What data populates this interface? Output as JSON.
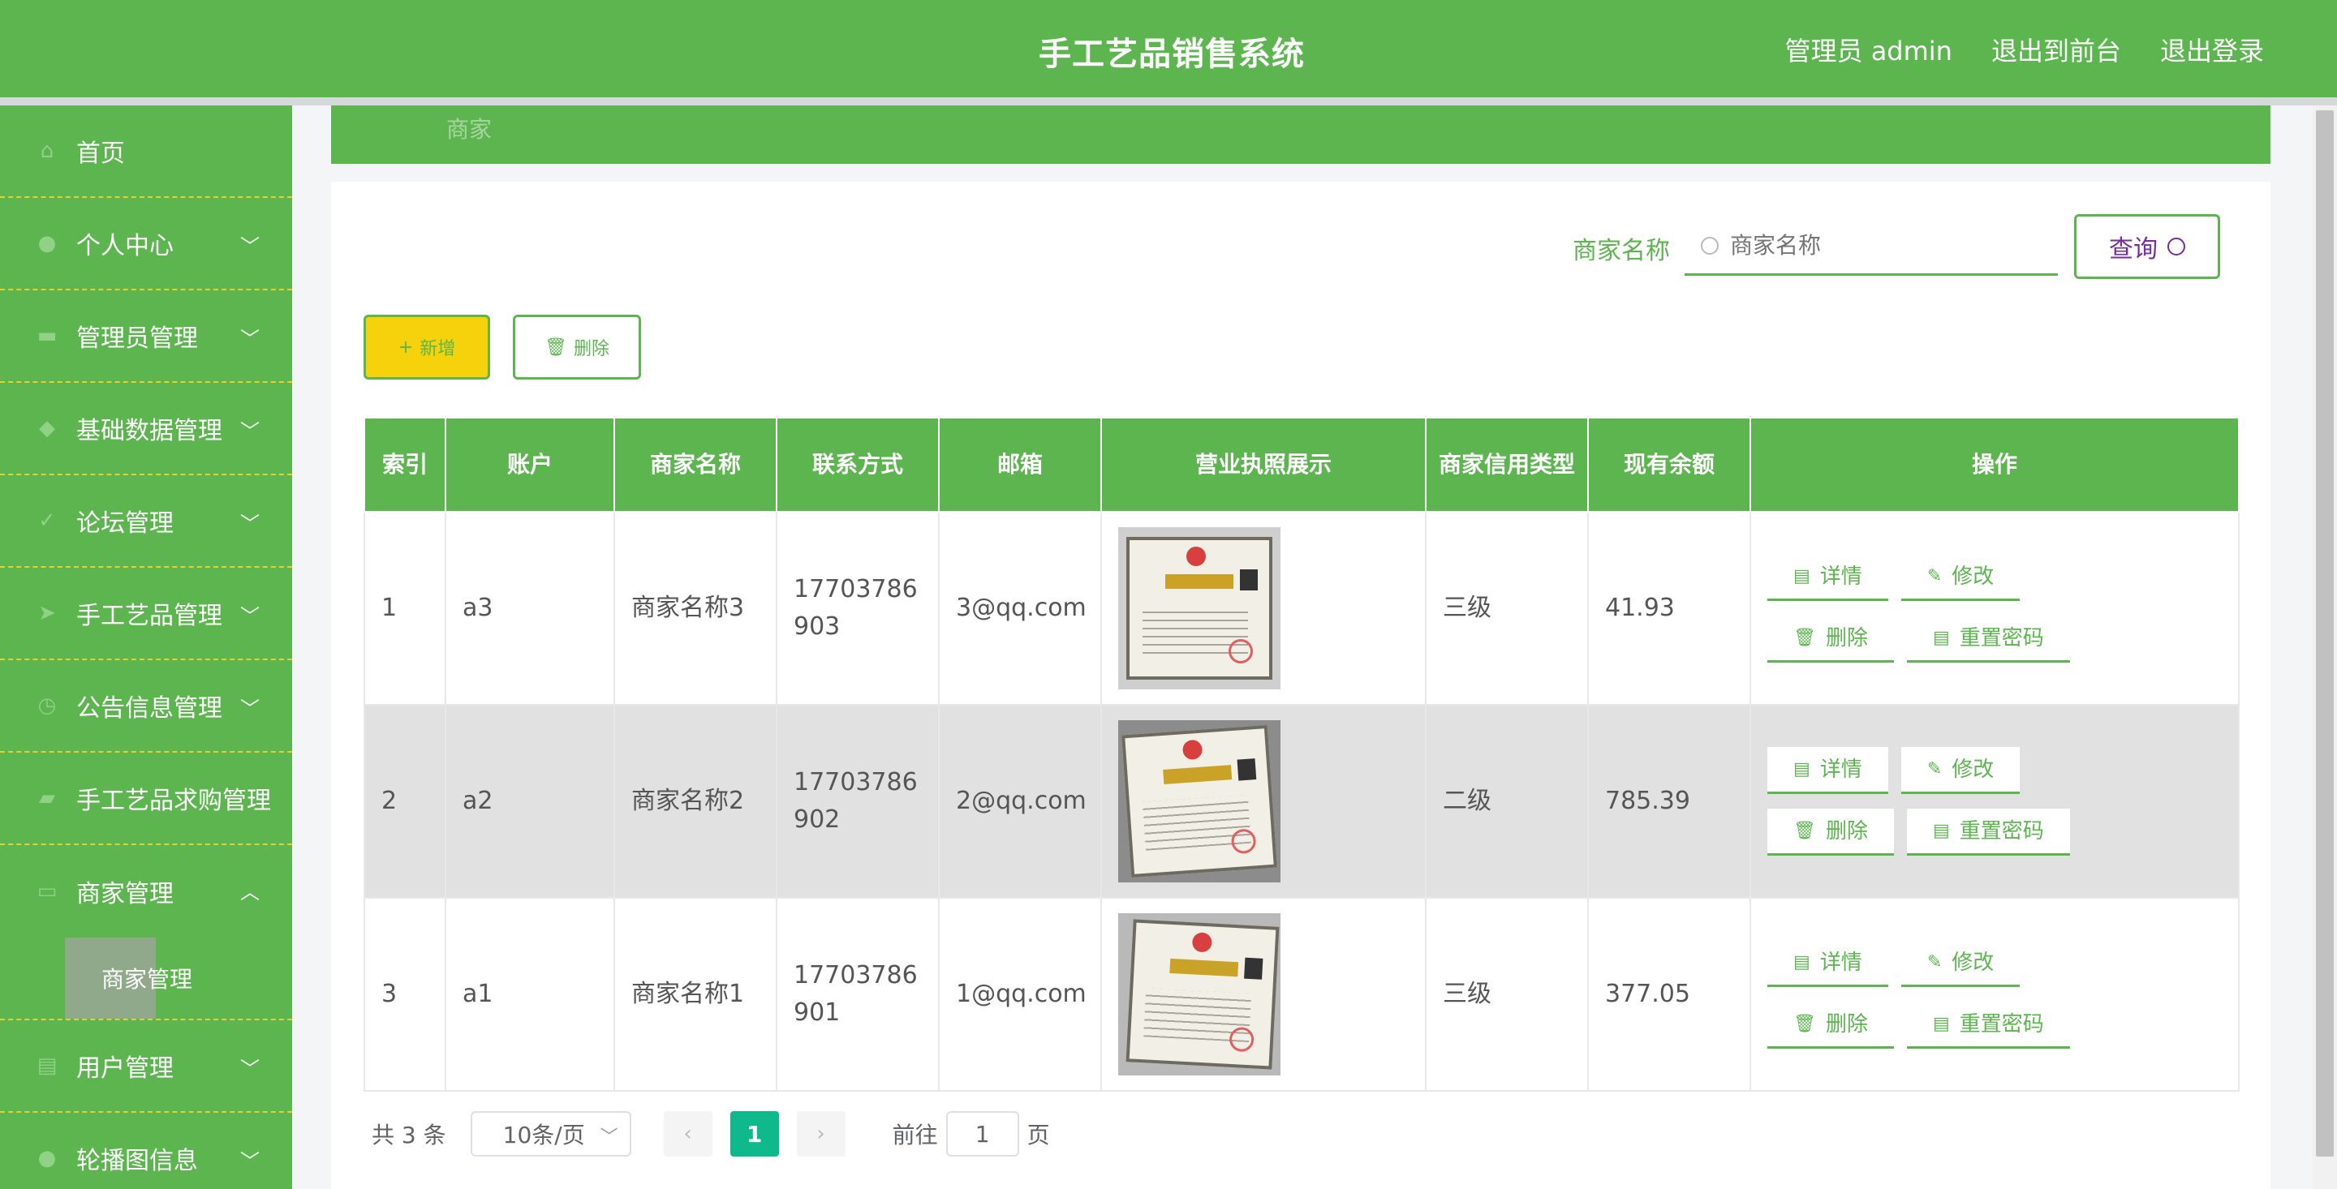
{
  "header": {
    "title": "手工艺品销售系统",
    "admin_label": "管理员 admin",
    "to_front": "退出到前台",
    "logout": "退出登录"
  },
  "sidebar": {
    "items": [
      {
        "label": "首页",
        "icon": "home-icon",
        "chevron": false
      },
      {
        "label": "个人中心",
        "icon": "user-icon",
        "chevron": true
      },
      {
        "label": "管理员管理",
        "icon": "monitor-icon",
        "chevron": true
      },
      {
        "label": "基础数据管理",
        "icon": "location-icon",
        "chevron": true
      },
      {
        "label": "论坛管理",
        "icon": "check-circle-icon",
        "chevron": true
      },
      {
        "label": "手工艺品管理",
        "icon": "send-icon",
        "chevron": true
      },
      {
        "label": "公告信息管理",
        "icon": "clock-icon",
        "chevron": true
      },
      {
        "label": "手工艺品求购管理",
        "icon": "briefcase-icon",
        "chevron": false
      },
      {
        "label": "商家管理",
        "icon": "mail-icon",
        "chevron": true
      },
      {
        "label": "用户管理",
        "icon": "folder-icon",
        "chevron": true
      },
      {
        "label": "轮播图信息",
        "icon": "user-icon",
        "chevron": true
      }
    ],
    "sub_item": "商家管理"
  },
  "breadcrumb": "商家",
  "search": {
    "label": "商家名称",
    "placeholder": "商家名称",
    "button": "查询"
  },
  "toolbar": {
    "add": "新增",
    "delete": "删除"
  },
  "table": {
    "headers": [
      "索引",
      "账户",
      "商家名称",
      "联系方式",
      "邮箱",
      "营业执照展示",
      "商家信用类型",
      "现有余额",
      "操作"
    ],
    "rows": [
      {
        "index": "1",
        "account": "a3",
        "name": "商家名称3",
        "phone": "17703786903",
        "email": "3@qq.com",
        "credit": "三级",
        "balance": "41.93"
      },
      {
        "index": "2",
        "account": "a2",
        "name": "商家名称2",
        "phone": "17703786902",
        "email": "2@qq.com",
        "credit": "二级",
        "balance": "785.39"
      },
      {
        "index": "3",
        "account": "a1",
        "name": "商家名称1",
        "phone": "17703786901",
        "email": "1@qq.com",
        "credit": "三级",
        "balance": "377.05"
      }
    ],
    "actions": {
      "detail": "详情",
      "edit": "修改",
      "delete": "删除",
      "reset": "重置密码"
    }
  },
  "pagination": {
    "total": "共 3 条",
    "page_size": "10条/页",
    "current": "1",
    "goto_label": "前往",
    "goto_value": "1",
    "page_suffix": "页"
  },
  "colors": {
    "primary_green": "#5cb54f",
    "add_yellow": "#f5d20c",
    "page_active": "#0fb98c"
  }
}
